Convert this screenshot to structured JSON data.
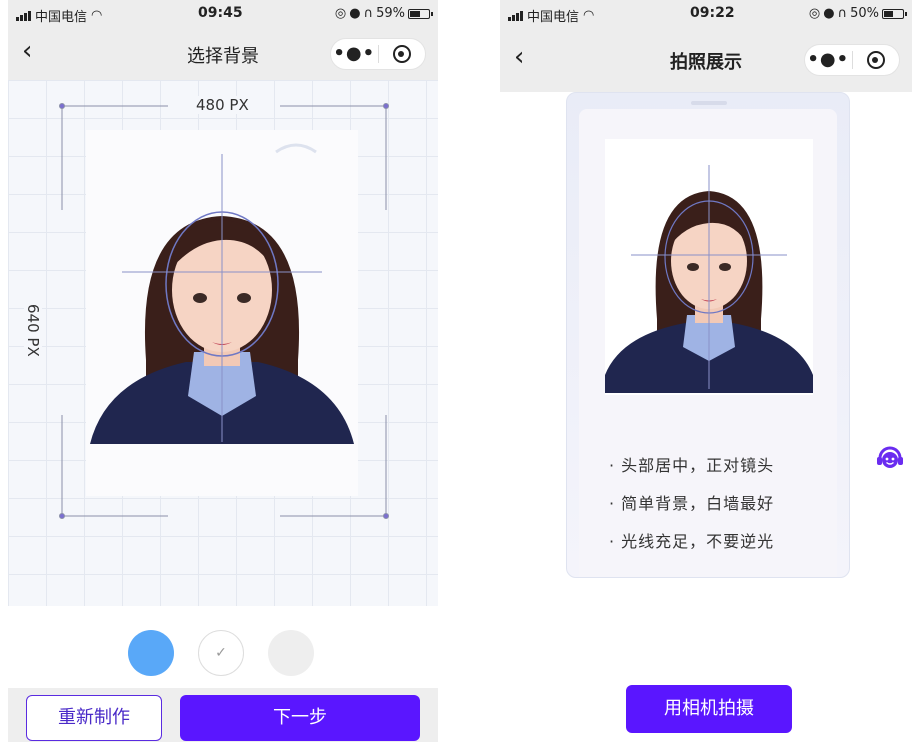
{
  "left_screen": {
    "status": {
      "carrier": "中国电信",
      "time": "09:45",
      "battery": "59%",
      "battery_level": 0.59
    },
    "nav": {
      "title": "选择背景"
    },
    "dimensions": {
      "width_label": "480 PX",
      "height_label": "640 PX"
    },
    "backgrounds": [
      {
        "color": "#59a8f8",
        "selected": false
      },
      {
        "color": "#ffffff",
        "selected": true,
        "mark": "✓"
      },
      {
        "color": "#eeeeee",
        "selected": false
      }
    ],
    "actions": {
      "redo_label": "重新制作",
      "next_label": "下一步"
    }
  },
  "right_screen": {
    "status": {
      "carrier": "中国电信",
      "time": "09:22",
      "battery": "50%",
      "battery_level": 0.5
    },
    "nav": {
      "title": "拍照展示"
    },
    "tips": [
      "· 头部居中，正对镜头",
      "· 简单背景，白墙最好",
      "· 光线充足，不要逆光"
    ],
    "camera_button_label": "用相机拍摄"
  },
  "colors": {
    "accent": "#5a16ff",
    "outline": "#5a2be0",
    "nav_bg": "#ededed",
    "guide": "#8a90c8"
  }
}
